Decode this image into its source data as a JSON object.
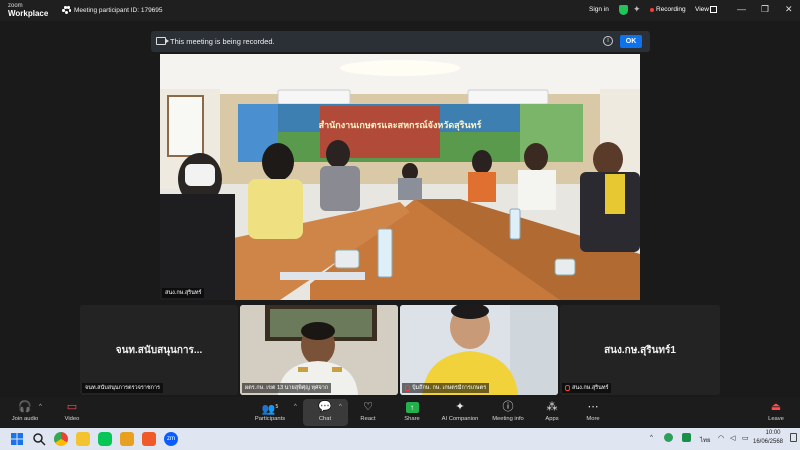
{
  "app": {
    "brand_small": "zoom",
    "brand_name": "Workplace"
  },
  "titlebar": {
    "meeting_id_text": "Meeting participant ID: 179695",
    "sign_in": "Sign in",
    "recording": "Recording",
    "view": "View"
  },
  "banner": {
    "text": "This meeting is being recorded.",
    "ok": "OK"
  },
  "main_video": {
    "name_tag": "สนง.กษ.สุรินทร์",
    "room_sign": "สำนักงานเกษตรและสหกรณ์จังหวัดสุรินทร์"
  },
  "tiles": [
    {
      "big_name": "จนท.สนับสนุนการ...",
      "tag": "จนท.สนับสนุนการตรวจราชการ",
      "muted": false
    },
    {
      "big_name": "",
      "tag": "ผตร.กษ. เขต 13 นายสุพิศุญ หุศจาก",
      "muted": false
    },
    {
      "big_name": "",
      "tag": "ปุ้มถึกษ. กษ. เกษตรมีการเกษตร",
      "muted": true
    },
    {
      "big_name": "สนง.กษ.สุรินทร์1",
      "tag": "สนง.กษ.สุรินทร์",
      "muted": true
    }
  ],
  "toolbar": {
    "join_audio": "Join audio",
    "video": "Video",
    "participants": "Participants",
    "participants_count": "5",
    "chat": "Chat",
    "react": "React",
    "share": "Share",
    "ai_companion": "AI Companion",
    "meeting_info": "Meeting info",
    "apps": "Apps",
    "more": "More",
    "leave": "Leave"
  },
  "taskbar": {
    "lang": "ไทย",
    "time": "10:00",
    "date": "16/06/2568",
    "zoom_app_label": "zm"
  },
  "colors": {
    "accent": "#0e72ed",
    "recording": "#ff3b30",
    "share": "#22b14c",
    "shield": "#21c35a"
  }
}
